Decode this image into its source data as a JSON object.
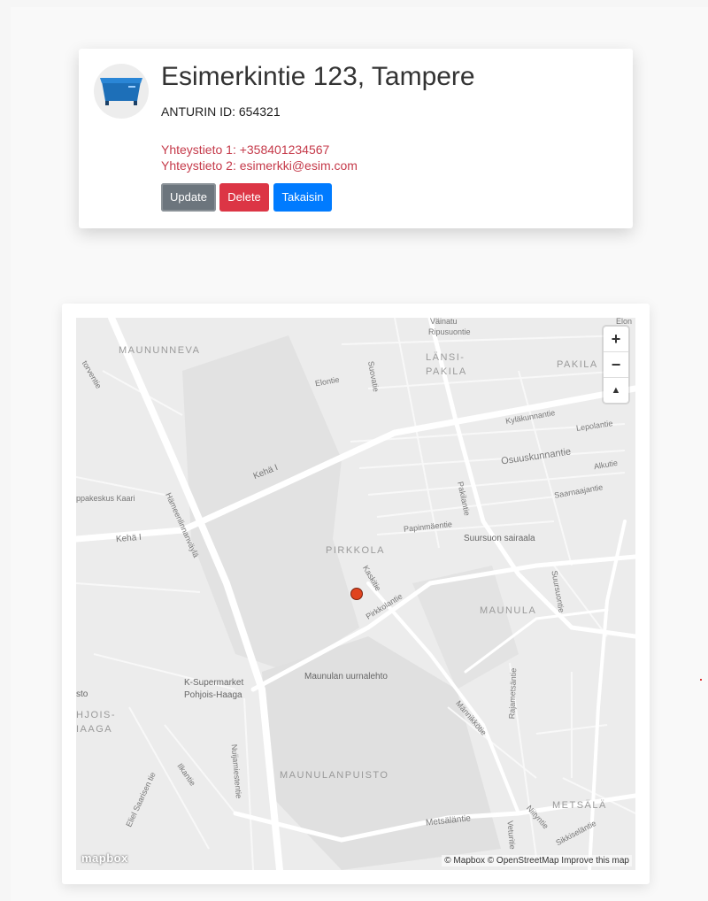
{
  "sensor": {
    "address": "Esimerkintie 123, Tampere",
    "sensor_id": "ANTURIN ID: 654321",
    "contact1": "Yhteystieto 1: +358401234567",
    "contact2": "Yhteystieto 2: esimerkki@esim.com",
    "avatar_icon": "bin-icon"
  },
  "buttons": {
    "update": "Update",
    "delete": "Delete",
    "back": "Takaisin"
  },
  "colors": {
    "contact_text": "#c53a4a",
    "update_btn": "#6c757d",
    "delete_btn": "#dc3545",
    "back_btn": "#007bff",
    "marker": "#e0441f"
  },
  "map": {
    "zoom_in": "+",
    "zoom_out": "−",
    "compass": "▲",
    "logo": "mapbox",
    "attribution": "© Mapbox © OpenStreetMap Improve this map",
    "areas": [
      "MAUNUNNEVA",
      "LÄNSI-",
      "PAKILA",
      "PAKILA",
      "PIRKKOLA",
      "MAUNULA",
      "MAUNULANPUISTO",
      "METSÄLÄ",
      "HJOIS-",
      "IAAGA"
    ],
    "streets": [
      "Väinatu",
      "Ripusuontie",
      "Elontie",
      "Suovatie",
      "Kyläkunnantie",
      "Lepolantie",
      "Osuuskunnantie",
      "Alkutie",
      "Saarnaajantie",
      "Papinmäentie",
      "Pakilantie",
      "Kehä I",
      "Hämeenlinnanväylä",
      "ppakeskus Kaari",
      "Kaskitie",
      "Pirkkolantie",
      "Suursuontie",
      "Rajametsäntie",
      "Männikkötie",
      "Nuijamiestentie",
      "Ilkantie",
      "Eliel Saarisen tie",
      "Metsäläntie",
      "Veturitie",
      "Niityntie",
      "Sikkiseläntie",
      "torventie",
      "Elon"
    ],
    "pois": [
      "Suursuon sairaala",
      "Maunulan uurnalehto",
      "K-Supermarket",
      "Pohjois-Haaga",
      "sto"
    ]
  }
}
